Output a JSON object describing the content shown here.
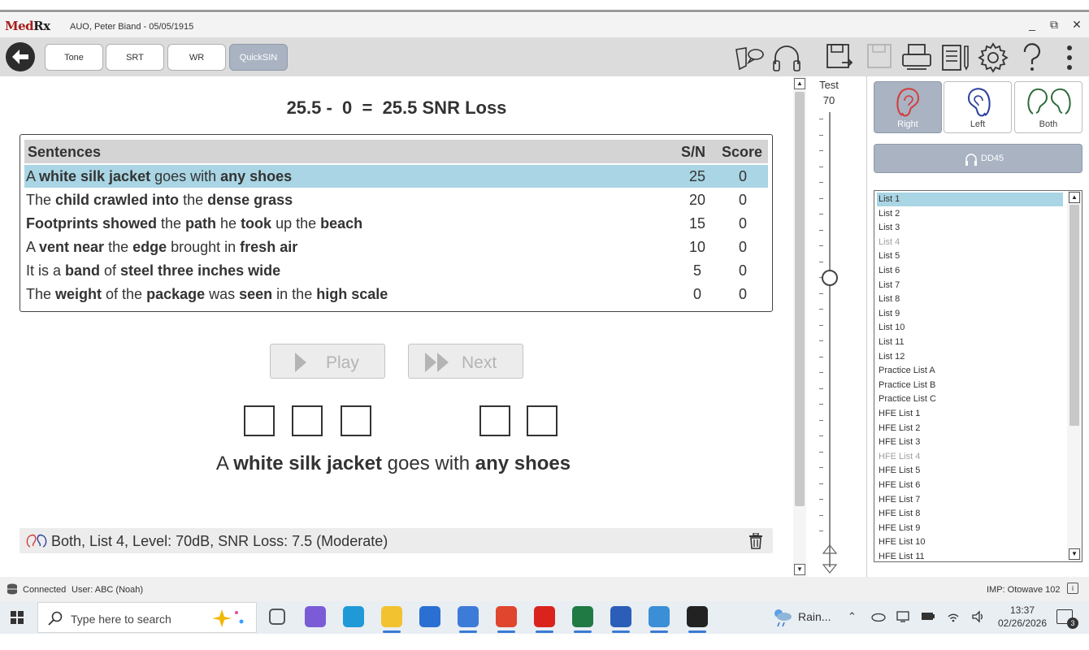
{
  "window": {
    "logo_main": "Med",
    "logo_suffix": "Rx",
    "title": "AUO, Peter Biand - 05/05/1915",
    "minimize": "_",
    "restore": "⧉",
    "close": "✕"
  },
  "toolbar": {
    "tabs": [
      {
        "label": "Tone",
        "active": false
      },
      {
        "label": "SRT",
        "active": false
      },
      {
        "label": "WR",
        "active": false
      },
      {
        "label": "QuickSIN",
        "active": true
      }
    ],
    "icons": [
      "speech-icon",
      "headphones-icon",
      "save-icon",
      "save-disabled-icon",
      "print-icon",
      "report-icon",
      "settings-icon",
      "help-icon",
      "more-vertical-icon"
    ]
  },
  "main": {
    "snr_equation": "25.5 -  0  =  25.5 SNR Loss",
    "table": {
      "headers": {
        "sentences": "Sentences",
        "sn": "S/N",
        "score": "Score"
      },
      "rows": [
        {
          "parts": [
            [
              "A ",
              false
            ],
            [
              "white silk jacket",
              true
            ],
            [
              " goes with ",
              false
            ],
            [
              "any shoes",
              true
            ]
          ],
          "sn": "25",
          "score": "0",
          "selected": true
        },
        {
          "parts": [
            [
              "The ",
              false
            ],
            [
              "child crawled into",
              true
            ],
            [
              " the ",
              false
            ],
            [
              "dense grass",
              true
            ]
          ],
          "sn": "20",
          "score": "0",
          "selected": false
        },
        {
          "parts": [
            [
              "Footprints showed",
              true
            ],
            [
              " the ",
              false
            ],
            [
              "path",
              true
            ],
            [
              " he ",
              false
            ],
            [
              "took",
              true
            ],
            [
              " up the ",
              false
            ],
            [
              "beach",
              true
            ]
          ],
          "sn": "15",
          "score": "0",
          "selected": false
        },
        {
          "parts": [
            [
              "A ",
              false
            ],
            [
              "vent near",
              true
            ],
            [
              " the ",
              false
            ],
            [
              "edge",
              true
            ],
            [
              " brought in ",
              false
            ],
            [
              "fresh air",
              true
            ]
          ],
          "sn": "10",
          "score": "0",
          "selected": false
        },
        {
          "parts": [
            [
              "It is a ",
              false
            ],
            [
              "band",
              true
            ],
            [
              " of ",
              false
            ],
            [
              "steel three inches wide",
              true
            ]
          ],
          "sn": "5",
          "score": "0",
          "selected": false
        },
        {
          "parts": [
            [
              "The ",
              false
            ],
            [
              "weight",
              true
            ],
            [
              " of the ",
              false
            ],
            [
              "package",
              true
            ],
            [
              " was ",
              false
            ],
            [
              "seen",
              true
            ],
            [
              " in the ",
              false
            ],
            [
              "high scale",
              true
            ]
          ],
          "sn": "0",
          "score": "0",
          "selected": false
        }
      ]
    },
    "play_label": "Play",
    "next_label": "Next",
    "current_sentence": [
      [
        "A ",
        false
      ],
      [
        "white",
        true
      ],
      [
        " ",
        false
      ],
      [
        "silk",
        true
      ],
      [
        " ",
        false
      ],
      [
        "jacket",
        true
      ],
      [
        " goes with ",
        false
      ],
      [
        "any",
        true
      ],
      [
        " ",
        false
      ],
      [
        "shoes",
        true
      ]
    ],
    "result_text": "Both, List 4, Level: 70dB, SNR Loss: 7.5 (Moderate)"
  },
  "level": {
    "label": "Test",
    "value": "70"
  },
  "right": {
    "ears": [
      {
        "label": "Right",
        "active": true,
        "color": "#d43b3b"
      },
      {
        "label": "Left",
        "active": false,
        "color": "#2b3f9e"
      },
      {
        "label": "Both",
        "active": false,
        "color": "#2f6b3c"
      }
    ],
    "transducer": "DD45",
    "lists": [
      {
        "label": "List 1",
        "selected": true,
        "dim": false
      },
      {
        "label": "List 2",
        "selected": false,
        "dim": false
      },
      {
        "label": "List 3",
        "selected": false,
        "dim": false
      },
      {
        "label": "List 4",
        "selected": false,
        "dim": true
      },
      {
        "label": "List 5",
        "selected": false,
        "dim": false
      },
      {
        "label": "List 6",
        "selected": false,
        "dim": false
      },
      {
        "label": "List 7",
        "selected": false,
        "dim": false
      },
      {
        "label": "List 8",
        "selected": false,
        "dim": false
      },
      {
        "label": "List 9",
        "selected": false,
        "dim": false
      },
      {
        "label": "List 10",
        "selected": false,
        "dim": false
      },
      {
        "label": "List 11",
        "selected": false,
        "dim": false
      },
      {
        "label": "List 12",
        "selected": false,
        "dim": false
      },
      {
        "label": "Practice List A",
        "selected": false,
        "dim": false
      },
      {
        "label": "Practice List B",
        "selected": false,
        "dim": false
      },
      {
        "label": "Practice List C",
        "selected": false,
        "dim": false
      },
      {
        "label": "HFE List 1",
        "selected": false,
        "dim": false
      },
      {
        "label": "HFE List 2",
        "selected": false,
        "dim": false
      },
      {
        "label": "HFE List 3",
        "selected": false,
        "dim": false
      },
      {
        "label": "HFE List 4",
        "selected": false,
        "dim": true
      },
      {
        "label": "HFE List 5",
        "selected": false,
        "dim": false
      },
      {
        "label": "HFE List 6",
        "selected": false,
        "dim": false
      },
      {
        "label": "HFE List 7",
        "selected": false,
        "dim": false
      },
      {
        "label": "HFE List 8",
        "selected": false,
        "dim": false
      },
      {
        "label": "HFE List 9",
        "selected": false,
        "dim": false
      },
      {
        "label": "HFE List 10",
        "selected": false,
        "dim": false
      },
      {
        "label": "HFE List 11",
        "selected": false,
        "dim": false
      }
    ]
  },
  "status": {
    "connection": "Connected",
    "user": "User: ABC (Noah)",
    "imp": "IMP: Otowave 102",
    "info": "i"
  },
  "taskbar": {
    "search_placeholder": "Type here to search",
    "weather": "Rain...",
    "time": "13:37",
    "date": "02/26/2026",
    "notifications": "3",
    "apps": [
      {
        "name": "task-view-icon",
        "color": "#555555",
        "running": false
      },
      {
        "name": "copilot-app-icon",
        "color": "#7b5cd6",
        "running": false
      },
      {
        "name": "edge-icon",
        "color": "#1f9ad6",
        "running": false
      },
      {
        "name": "file-explorer-icon",
        "color": "#f2c230",
        "running": true
      },
      {
        "name": "store-icon",
        "color": "#2a6fd1",
        "running": false
      },
      {
        "name": "app-installer-icon",
        "color": "#3d7bd8",
        "running": true
      },
      {
        "name": "chrome-icon",
        "color": "#e0452e",
        "running": true
      },
      {
        "name": "acrobat-icon",
        "color": "#d9231c",
        "running": true
      },
      {
        "name": "excel-icon",
        "color": "#1f7a44",
        "running": true
      },
      {
        "name": "word-icon",
        "color": "#2b5eb8",
        "running": true
      },
      {
        "name": "globe-app-icon",
        "color": "#3a8fd6",
        "running": true
      },
      {
        "name": "medrx-app-icon",
        "color": "#222222",
        "running": true
      }
    ]
  }
}
